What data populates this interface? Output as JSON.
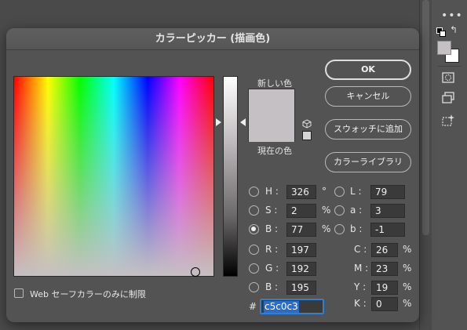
{
  "toolbar": {
    "more_icon": "more-dots-icon",
    "fg_color": "#c5c0c3",
    "bg_color": "#ffffff",
    "tools": [
      "quick-mask-icon",
      "screen-mode-icon",
      "magic-fill-icon"
    ]
  },
  "dialog": {
    "title": "カラーピッカー (描画色)",
    "new_label": "新しい色",
    "current_label": "現在の色",
    "new_color": "#c5c0c3",
    "current_color": "#c5c0c3",
    "buttons": {
      "ok": "OK",
      "cancel": "キャンセル",
      "add_swatch": "スウォッチに追加",
      "color_library": "カラーライブラリ"
    },
    "hsb": {
      "h_label": "H :",
      "h_value": "326",
      "h_unit": "°",
      "s_label": "S :",
      "s_value": "2",
      "s_unit": "%",
      "b_label": "B :",
      "b_value": "77",
      "b_unit": "%",
      "selected": "B"
    },
    "rgb": {
      "r_label": "R :",
      "r_value": "197",
      "g_label": "G :",
      "g_value": "192",
      "b_label": "B :",
      "b_value": "195"
    },
    "lab": {
      "l_label": "L :",
      "l_value": "79",
      "a_label": "a :",
      "a_value": "3",
      "b_label": "b :",
      "b_value": "-1"
    },
    "cmyk": {
      "c_label": "C :",
      "c_value": "26",
      "m_label": "M :",
      "m_value": "23",
      "y_label": "Y :",
      "y_value": "19",
      "k_label": "K :",
      "k_value": "0",
      "unit": "%"
    },
    "hex": {
      "hash": "#",
      "value": "c5c0c3"
    },
    "websafe_label": "Web セーフカラーのみに制限"
  }
}
